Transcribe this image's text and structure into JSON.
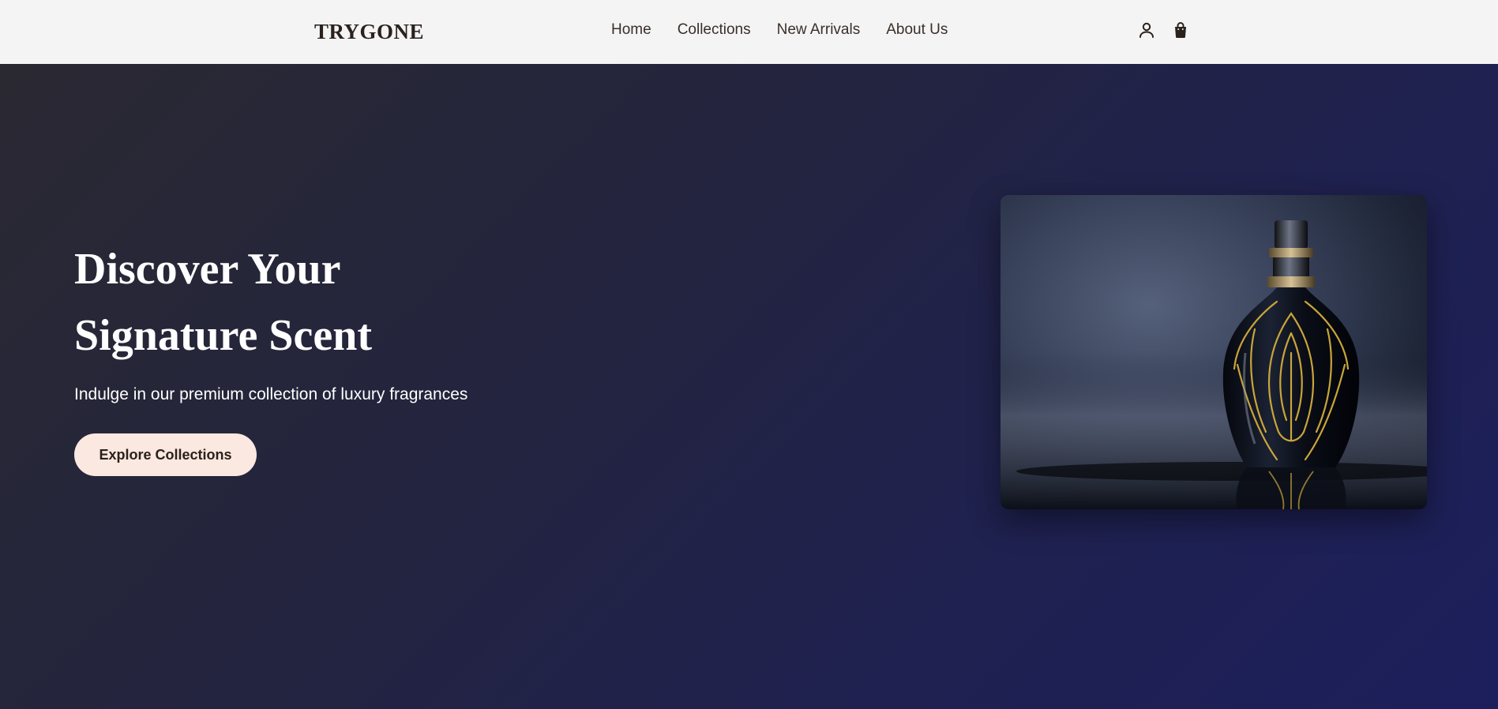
{
  "header": {
    "brand": "TRYGONE",
    "nav": [
      {
        "label": "Home"
      },
      {
        "label": "Collections"
      },
      {
        "label": "New Arrivals"
      },
      {
        "label": "About Us"
      }
    ],
    "icons": [
      "user-icon",
      "shopping-bag-icon"
    ]
  },
  "hero": {
    "title_line1": "Discover Your",
    "title_line2": "Signature Scent",
    "subtitle": "Indulge in our premium collection of luxury fragrances",
    "cta_label": "Explore Collections",
    "image": "perfume-bottle-image"
  },
  "colors": {
    "nav_bg": "#f4f4f4",
    "brand_text": "#2b211c",
    "hero_bg_start": "#2a2932",
    "hero_bg_end": "#1c1f5c",
    "cta_bg": "#fbe8e0",
    "gold": "#c9a53a"
  }
}
